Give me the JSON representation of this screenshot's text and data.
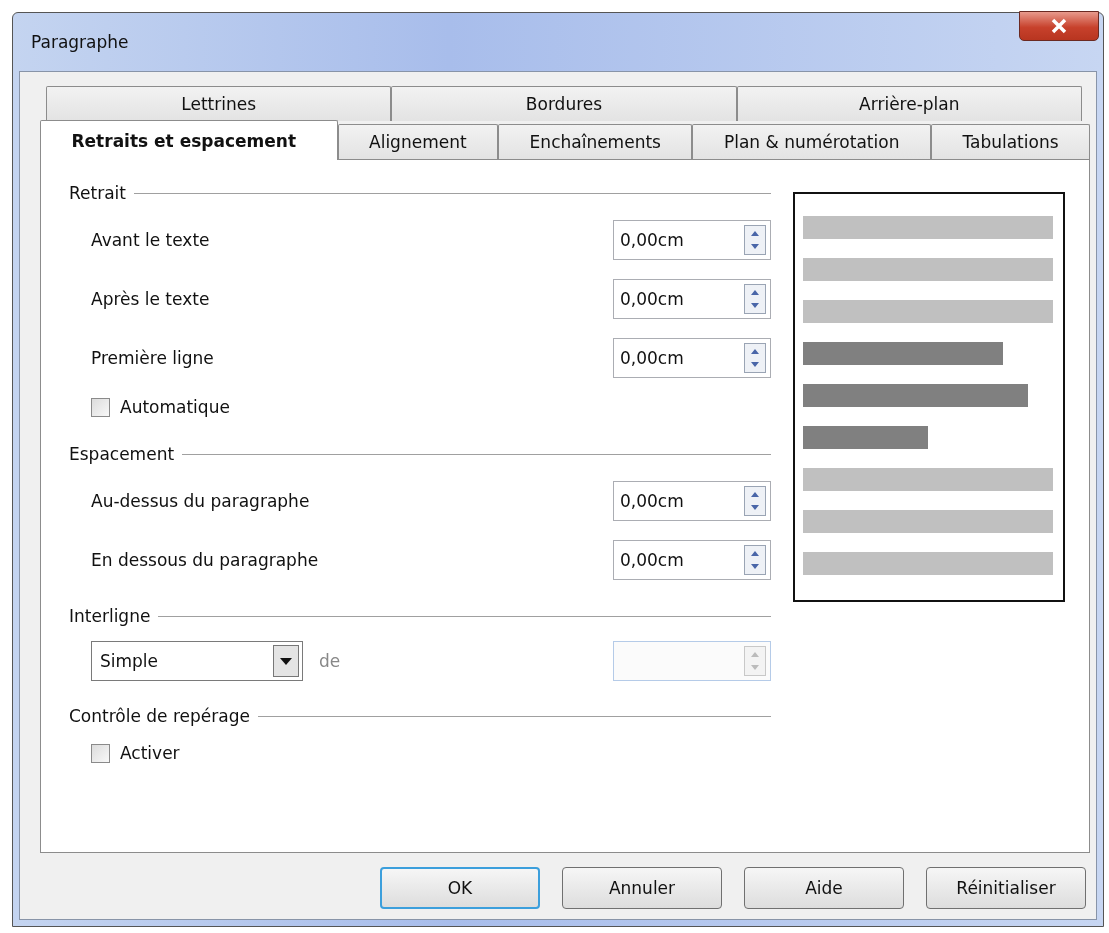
{
  "window": {
    "title": "Paragraphe"
  },
  "tab_rows": [
    [
      {
        "label": "Lettrines",
        "selected": false
      },
      {
        "label": "Bordures",
        "selected": false
      },
      {
        "label": "Arrière-plan",
        "selected": false
      }
    ],
    [
      {
        "label": "Retraits et espacement",
        "selected": true
      },
      {
        "label": "Alignement",
        "selected": false
      },
      {
        "label": "Enchaînements",
        "selected": false
      },
      {
        "label": "Plan & numérotation",
        "selected": false
      },
      {
        "label": "Tabulations",
        "selected": false
      }
    ]
  ],
  "sections": [
    {
      "title": "Retrait",
      "items": [
        {
          "kind": "spin",
          "label": "Avant le texte",
          "value": "0,00cm",
          "disabled": false
        },
        {
          "kind": "spin",
          "label": "Après le texte",
          "value": "0,00cm",
          "disabled": false
        },
        {
          "kind": "spin",
          "label": "Première ligne",
          "value": "0,00cm",
          "disabled": false
        },
        {
          "kind": "checkbox",
          "label": "Automatique",
          "checked": false
        }
      ]
    },
    {
      "title": "Espacement",
      "items": [
        {
          "kind": "spin",
          "label": "Au-dessus du paragraphe",
          "value": "0,00cm",
          "disabled": false
        },
        {
          "kind": "spin",
          "label": "En dessous du paragraphe",
          "value": "0,00cm",
          "disabled": false
        }
      ]
    },
    {
      "title": "Interligne",
      "items": [
        {
          "kind": "dropdown",
          "value": "Simple",
          "label": "de",
          "spin_disabled": true
        }
      ]
    },
    {
      "title": "Contrôle de repérage",
      "items": [
        {
          "kind": "checkbox",
          "label": "Activer",
          "checked": false
        }
      ]
    }
  ],
  "buttons": [
    {
      "label": "OK",
      "default": true
    },
    {
      "label": "Annuler",
      "default": false
    },
    {
      "label": "Aide",
      "default": false
    },
    {
      "label": "Réinitialiser",
      "default": false
    }
  ]
}
